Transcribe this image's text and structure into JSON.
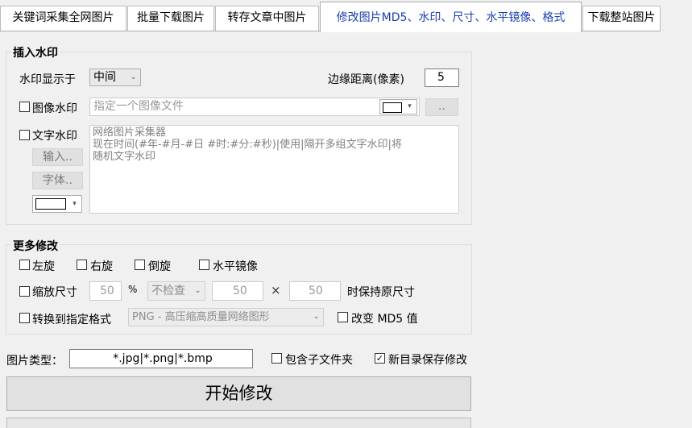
{
  "tabs": [
    {
      "label": "关键词采集全网图片"
    },
    {
      "label": "批量下载图片"
    },
    {
      "label": "转存文章中图片"
    },
    {
      "label": "修改图片MD5、水印、尺寸、水平镜像、格式"
    },
    {
      "label": "下载整站图片"
    }
  ],
  "watermark": {
    "title": "插入水印",
    "position_label": "水印显示于",
    "position_value": "中间",
    "margin_label": "边缘距离(像素)",
    "margin_value": "5",
    "image_wm_label": "图像水印",
    "image_wm_checked": false,
    "image_file_placeholder": "指定一个图像文件",
    "browse_label": "..",
    "text_wm_label": "文字水印",
    "text_wm_checked": false,
    "input_button": "输入..",
    "font_button": "字体..",
    "text_lines": [
      "网络图片采集器",
      "现在时间(#年-#月-#日 #时:#分:#秒)|使用|隔开多组文字水印|将",
      "随机文字水印"
    ]
  },
  "more": {
    "title": "更多修改",
    "rotate_left": "左旋",
    "rotate_right": "右旋",
    "flip": "倒旋",
    "mirror": "水平镜像",
    "resize_label": "缩放尺寸",
    "scale_value": "50",
    "percent": "%",
    "check_option": "不检查",
    "width_value": "50",
    "times": "×",
    "height_value": "50",
    "keep_label": "时保持原尺寸",
    "convert_label": "转换到指定格式",
    "format_value": "PNG -  高压缩高质量网络图形",
    "md5_label": "改变 MD5 值"
  },
  "footer": {
    "types_label": "图片类型：",
    "types_value": "*.jpg|*.png|*.bmp",
    "subfolder_label": "包含子文件夹",
    "subfolder_checked": false,
    "newdir_label": "新目录保存修改",
    "newdir_checked": true,
    "start_button": "开始修改"
  }
}
